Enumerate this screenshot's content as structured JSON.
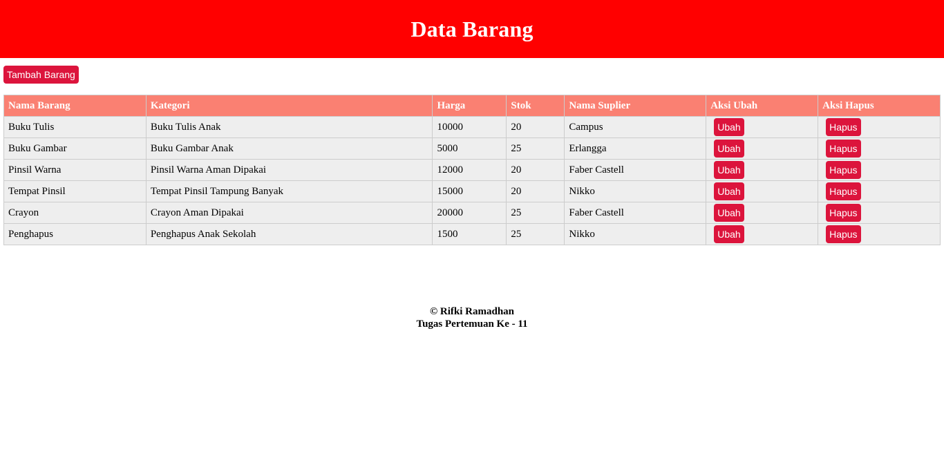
{
  "header": {
    "title": "Data Barang"
  },
  "toolbar": {
    "add_label": "Tambah Barang"
  },
  "table": {
    "columns": [
      "Nama Barang",
      "Kategori",
      "Harga",
      "Stok",
      "Nama Suplier",
      "Aksi Ubah",
      "Aksi Hapus"
    ],
    "edit_label": "Ubah",
    "delete_label": "Hapus",
    "rows": [
      {
        "nama": "Buku Tulis",
        "kategori": "Buku Tulis Anak",
        "harga": "10000",
        "stok": "20",
        "suplier": "Campus"
      },
      {
        "nama": "Buku Gambar",
        "kategori": "Buku Gambar Anak",
        "harga": "5000",
        "stok": "25",
        "suplier": "Erlangga"
      },
      {
        "nama": "Pinsil Warna",
        "kategori": "Pinsil Warna Aman Dipakai",
        "harga": "12000",
        "stok": "20",
        "suplier": "Faber Castell"
      },
      {
        "nama": "Tempat Pinsil",
        "kategori": "Tempat Pinsil Tampung Banyak",
        "harga": "15000",
        "stok": "20",
        "suplier": "Nikko"
      },
      {
        "nama": "Crayon",
        "kategori": "Crayon Aman Dipakai",
        "harga": "20000",
        "stok": "25",
        "suplier": "Faber Castell"
      },
      {
        "nama": "Penghapus",
        "kategori": "Penghapus Anak Sekolah",
        "harga": "1500",
        "stok": "25",
        "suplier": "Nikko"
      }
    ]
  },
  "footer": {
    "line1": "© Rifki Ramadhan",
    "line2": "Tugas Pertemuan Ke - 11"
  },
  "colors": {
    "header_bg": "#ff0000",
    "button_bg": "#dc143c",
    "table_header_bg": "#fa8072",
    "table_row_bg": "#eeeeee"
  }
}
